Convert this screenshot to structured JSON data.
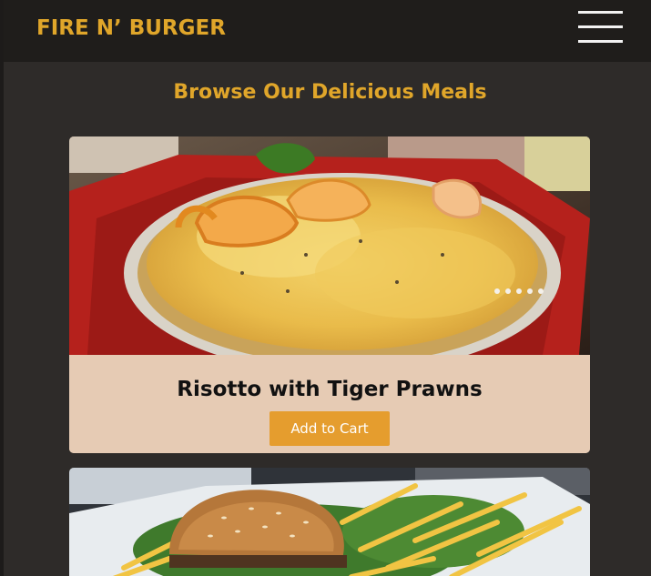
{
  "header": {
    "brand": "FIRE N’ BURGER",
    "menu_icon": "hamburger-menu-icon"
  },
  "main": {
    "title": "Browse Our Delicious Meals",
    "meals": [
      {
        "name": "Risotto with Tiger Prawns",
        "button_label": "Add to Cart",
        "image": "risotto-with-prawns-photo"
      },
      {
        "image": "burger-and-fries-photo"
      }
    ]
  },
  "colors": {
    "brand": "#e0a62a",
    "navbar": "#1f1d1b",
    "background": "#2e2b29",
    "card": "#e6cbb4",
    "button": "#e59d2e"
  }
}
